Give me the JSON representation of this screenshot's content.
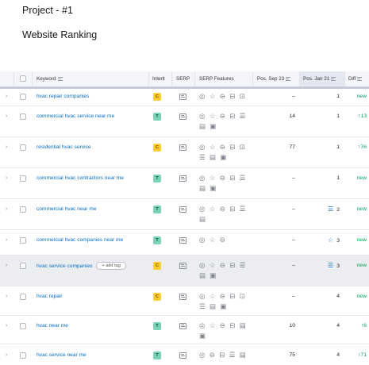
{
  "project_title": "Project - #1",
  "page_title": "Website Ranking",
  "header": {
    "keyword": "Keyword",
    "intent": "Intent",
    "serp": "SERP",
    "serp_features": "SERP Features",
    "pos_sep": "Pos. Sep 23",
    "pos_jan": "Pos. Jan 21",
    "diff": "Diff"
  },
  "rows": [
    {
      "keyword": "hvac repair companies",
      "intent": "C",
      "features": [
        "◎ ☆ ⊖ ⊟ ⊡"
      ],
      "pos_sep": "–",
      "pos_jan": "1",
      "jan_icon": "",
      "diff": "new",
      "tag": ""
    },
    {
      "keyword": "commercial hvac service near me",
      "intent": "T",
      "features": [
        "◎ ☆ ⊖ ⊟ ☰",
        "▤ ▣"
      ],
      "pos_sep": "14",
      "pos_jan": "1",
      "jan_icon": "",
      "diff": "↑13",
      "tag": ""
    },
    {
      "keyword": "residential hvac service",
      "intent": "C",
      "features": [
        "◎ ☆ ⊖ ⊟ ⊡",
        "☰ ▤ ▣"
      ],
      "pos_sep": "77",
      "pos_jan": "1",
      "jan_icon": "",
      "diff": "↑76",
      "tag": ""
    },
    {
      "keyword": "commercial hvac contractors near me",
      "intent": "T",
      "features": [
        "◎ ☆ ⊖ ⊟ ☰",
        "▤ ▣"
      ],
      "pos_sep": "–",
      "pos_jan": "1",
      "jan_icon": "",
      "diff": "new",
      "tag": ""
    },
    {
      "keyword": "commercial hvac near me",
      "intent": "T",
      "features": [
        "◎ ☆ ⊖ ⊟ ☰",
        "▤"
      ],
      "pos_sep": "–",
      "pos_jan": "2",
      "jan_icon": "☰",
      "diff": "new",
      "tag": ""
    },
    {
      "keyword": "commercial hvac companies near me",
      "intent": "T",
      "features": [
        "◎ ☆ ⊖"
      ],
      "pos_sep": "–",
      "pos_jan": "3",
      "jan_icon": "☆",
      "diff": "new",
      "tag": ""
    },
    {
      "keyword": "hvac service companies",
      "intent": "C",
      "features": [
        "◎ ☆ ⊖ ⊟ ☰",
        "▤ ▣"
      ],
      "pos_sep": "–",
      "pos_jan": "3",
      "jan_icon": "☰",
      "diff": "new",
      "tag": "+ add tag"
    },
    {
      "keyword": "hvac repair",
      "intent": "C",
      "features": [
        "◎ ☆ ⊖ ⊟ ⊡",
        "☰ ▤ ▣"
      ],
      "pos_sep": "–",
      "pos_jan": "4",
      "jan_icon": "",
      "diff": "new",
      "tag": ""
    },
    {
      "keyword": "hvac near me",
      "intent": "T",
      "features": [
        "◎ ☆ ⊖ ⊟ ▤",
        "▣"
      ],
      "pos_sep": "10",
      "pos_jan": "4",
      "jan_icon": "",
      "diff": "↑6",
      "tag": ""
    },
    {
      "keyword": "hvac service near me",
      "intent": "T",
      "features": [
        "◎ ⊖ ⊟ ☰ ▤"
      ],
      "pos_sep": "75",
      "pos_jan": "4",
      "jan_icon": "",
      "diff": "↑71",
      "tag": ""
    }
  ]
}
